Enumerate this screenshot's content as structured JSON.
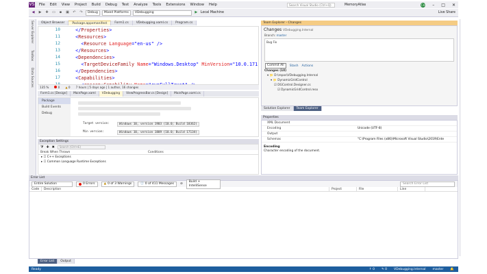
{
  "app": {
    "logo": "VS",
    "window_title": "MemoryAtlas",
    "search_placeholder": "Search Visual Studio (Ctrl+Q)",
    "avatar": "CH",
    "live_share": "Live Share"
  },
  "menu": [
    "File",
    "Edit",
    "View",
    "Project",
    "Build",
    "Debug",
    "Test",
    "Analyze",
    "Tools",
    "Extensions",
    "Window",
    "Help"
  ],
  "toolbar": {
    "config": "Debug",
    "platform": "Mixed Platforms",
    "startup": "VDebugging",
    "run": "Local Machine"
  },
  "left_tabs": [
    "Server Explorer",
    "Toolbox",
    "Data Sources"
  ],
  "doc_tabs": [
    "Object Browser",
    "Package.appxmanifest",
    "Form1.cs",
    "VDebugging.xaml.cs",
    "Program.cs"
  ],
  "editor": {
    "line_numbers": [
      "10",
      "11",
      "12",
      "13",
      "14",
      "15",
      "16",
      "17",
      "18"
    ],
    "lines": [
      [
        [
          "pun",
          "  </"
        ],
        [
          "tag",
          "Properties"
        ],
        [
          "pun",
          ">"
        ]
      ],
      [
        [
          "pun",
          "  <"
        ],
        [
          "tag",
          "Resources"
        ],
        [
          "pun",
          ">"
        ]
      ],
      [
        [
          "pun",
          "    <"
        ],
        [
          "tag",
          "Resource"
        ],
        [
          "attr",
          " Language"
        ],
        [
          "pun",
          "="
        ],
        [
          "val",
          "\"en-us\""
        ],
        [
          "pun",
          " />"
        ]
      ],
      [
        [
          "pun",
          "  </"
        ],
        [
          "tag",
          "Resources"
        ],
        [
          "pun",
          ">"
        ]
      ],
      [
        [
          "pun",
          "  <"
        ],
        [
          "tag",
          "Dependencies"
        ],
        [
          "pun",
          ">"
        ]
      ],
      [
        [
          "pun",
          "    <"
        ],
        [
          "tag",
          "TargetDeviceFamily"
        ],
        [
          "attr",
          " Name"
        ],
        [
          "pun",
          "="
        ],
        [
          "val",
          "\"Windows.Desktop\""
        ],
        [
          "attr",
          " MinVersion"
        ],
        [
          "pun",
          "="
        ],
        [
          "val",
          "\"10.0.171"
        ]
      ],
      [
        [
          "pun",
          "  </"
        ],
        [
          "tag",
          "Dependencies"
        ],
        [
          "pun",
          ">"
        ]
      ],
      [
        [
          "pun",
          "  <"
        ],
        [
          "tag",
          "Capabilities"
        ],
        [
          "pun",
          ">"
        ]
      ],
      [
        [
          "pun",
          "    <"
        ],
        [
          "tag",
          "rescap:Capability"
        ],
        [
          "attr",
          " Name"
        ],
        [
          "pun",
          "="
        ],
        [
          "val",
          "\"runFullTrust\""
        ],
        [
          "pun",
          " />"
        ]
      ]
    ]
  },
  "editor_status": {
    "zoom": "135 %",
    "issues": "0",
    "warnings": "0",
    "git": "7 hours | 5 days ago | 1 author, 16 changes"
  },
  "doc_tabs2": [
    "Form1.cs [Design]",
    "MainPage.xaml",
    "VDebugging",
    "ViewProgressBar.cs [Design]",
    "MainPage.xaml.cs"
  ],
  "manifest": {
    "side": [
      "Package",
      "Build Events",
      "Debug"
    ],
    "target_version_label": "Target version:",
    "target_version": "Windows 10, version 1903 (10.0; Build 18362)",
    "min_version_label": "Min version:",
    "min_version": "Windows 10, version 1809 (10.0; Build 17134)"
  },
  "exceptions": {
    "title": "Exception Settings",
    "search": "Search (Ctrl+E)",
    "col_break": "Break When Thrown",
    "col_conditions": "Conditions",
    "rows": [
      "C++ Exceptions",
      "Common Language Runtime Exceptions"
    ]
  },
  "team": {
    "title": "Team Explorer - Changes",
    "heading": "Changes",
    "repo": "VDebugging.Internal",
    "branch_label": "Branch:",
    "branch": "master",
    "commit_msg": "Bug Fix",
    "commit_all": "Commit All",
    "stash": "Stash",
    "actions": "Actions",
    "changes_header": "Changes (10)",
    "items": [
      "D:\\repos\\VDebugging.Internal",
      "DynamicGridControl",
      "DGControl.Designer.cs",
      "DynamicGridControl.resx"
    ]
  },
  "team_tabs": [
    "Solution Explorer",
    "Team Explorer"
  ],
  "properties": {
    "title": "Properties",
    "object": "XML Document",
    "rows": [
      [
        "Encoding",
        "Unicode (UTF-8)"
      ],
      [
        "Output",
        ""
      ],
      [
        "Schemas",
        "\"C:\\Program Files (x86)\\Microsoft Visual Studio\\2019\\Ente"
      ]
    ],
    "desc_title": "Encoding",
    "desc": "Character encoding of the document."
  },
  "errors": {
    "title": "Error List",
    "scope": "Entire Solution",
    "errors": "0 Errors",
    "warnings": "0 of 3 Warnings",
    "messages": "0 of 411 Messages",
    "build": "Build + IntelliSense",
    "search": "Search Error List",
    "cols": [
      "Code",
      "Description",
      "Project",
      "File",
      "Line"
    ]
  },
  "bottom_tabs": [
    "Error List",
    "Output"
  ],
  "status": {
    "ready": "Ready",
    "up": "↑ 0",
    "pending": "✎ 0",
    "repo": "VDebugging.Internal",
    "branch": "master"
  }
}
